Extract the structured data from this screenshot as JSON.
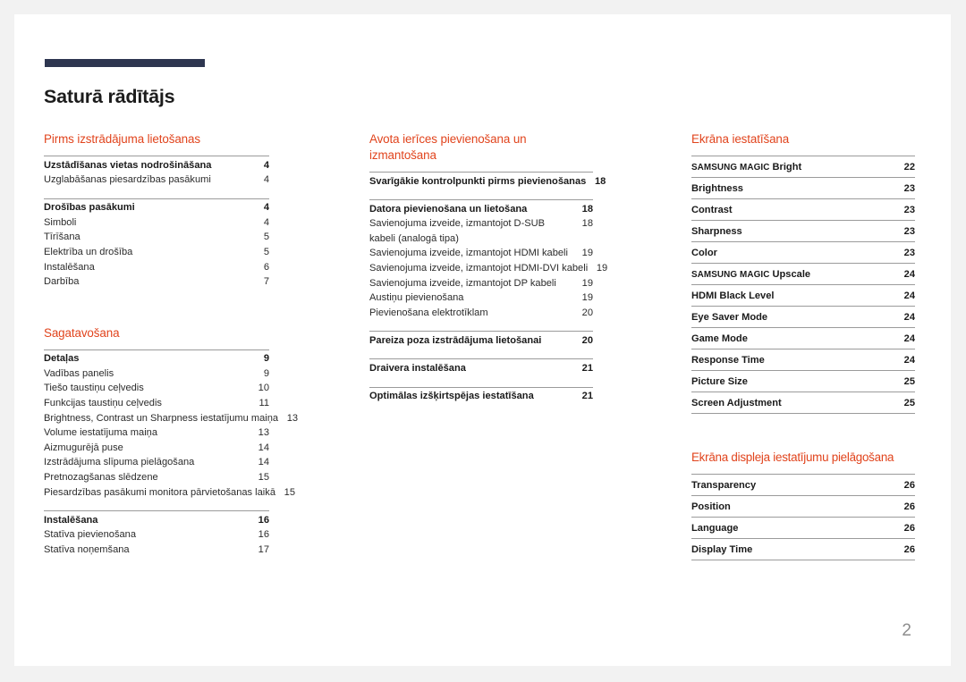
{
  "document": {
    "title": "Saturā rādītājs",
    "folio": "2",
    "accent_heading_color": "#e1441d",
    "rule_color": "#2e3650",
    "folio_color": "#8d8d8d"
  },
  "columns": [
    {
      "id": "column-1",
      "sections": [
        {
          "heading": "Pirms izstrādājuma lietošanas",
          "groups": [
            {
              "entries": [
                {
                  "label": "Uzstādīšanas vietas nodrošināšana",
                  "page": "4",
                  "level": "head"
                },
                {
                  "label": "Uzglabāšanas piesardzības pasākumi",
                  "page": "4",
                  "level": "sub"
                }
              ]
            },
            {
              "entries": [
                {
                  "label": "Drošības pasākumi",
                  "page": "4",
                  "level": "head"
                },
                {
                  "label": "Simboli",
                  "page": "4",
                  "level": "sub"
                },
                {
                  "label": "Tīrīšana",
                  "page": "5",
                  "level": "sub"
                },
                {
                  "label": "Elektrība un drošība",
                  "page": "5",
                  "level": "sub"
                },
                {
                  "label": "Instalēšana",
                  "page": "6",
                  "level": "sub"
                },
                {
                  "label": "Darbība",
                  "page": "7",
                  "level": "sub"
                }
              ]
            }
          ]
        },
        {
          "heading": "Sagatavošana",
          "groups": [
            {
              "entries": [
                {
                  "label": "Detaļas",
                  "page": "9",
                  "level": "head"
                },
                {
                  "label": "Vadības panelis",
                  "page": "9",
                  "level": "sub"
                },
                {
                  "label": "Tiešo taustiņu ceļvedis",
                  "page": "10",
                  "level": "sub"
                },
                {
                  "label": "Funkcijas taustiņu ceļvedis",
                  "page": "11",
                  "level": "sub"
                },
                {
                  "label": "Brightness, Contrast un Sharpness iestatījumu maiņa",
                  "page": "13",
                  "level": "sub"
                },
                {
                  "label": "Volume iestatījuma maiņa",
                  "page": "13",
                  "level": "sub"
                },
                {
                  "label": "Aizmugurējā puse",
                  "page": "14",
                  "level": "sub"
                },
                {
                  "label": "Izstrādājuma slīpuma pielāgošana",
                  "page": "14",
                  "level": "sub"
                },
                {
                  "label": "Pretnozagšanas slēdzene",
                  "page": "15",
                  "level": "sub"
                },
                {
                  "label": "Piesardzības pasākumi monitora pārvietošanas laikā",
                  "page": "15",
                  "level": "sub"
                }
              ]
            },
            {
              "entries": [
                {
                  "label": "Instalēšana",
                  "page": "16",
                  "level": "head"
                },
                {
                  "label": "Statīva pievienošana",
                  "page": "16",
                  "level": "sub"
                },
                {
                  "label": "Statīva noņemšana",
                  "page": "17",
                  "level": "sub"
                }
              ]
            }
          ]
        }
      ]
    },
    {
      "id": "column-2",
      "sections": [
        {
          "heading": "Avota ierīces pievienošana un izmantošana",
          "groups": [
            {
              "entries": [
                {
                  "label": "Svarīgākie kontrolpunkti pirms pievienošanas",
                  "page": "18",
                  "level": "head"
                }
              ]
            },
            {
              "entries": [
                {
                  "label": "Datora pievienošana un lietošana",
                  "page": "18",
                  "level": "head"
                },
                {
                  "label": "Savienojuma izveide, izmantojot D-SUB kabeli (analogā tipa)",
                  "page": "18",
                  "level": "sub-wrap"
                },
                {
                  "label": "Savienojuma izveide, izmantojot HDMI kabeli",
                  "page": "19",
                  "level": "sub"
                },
                {
                  "label": "Savienojuma izveide, izmantojot HDMI-DVI kabeli",
                  "page": "19",
                  "level": "sub"
                },
                {
                  "label": "Savienojuma izveide, izmantojot DP kabeli",
                  "page": "19",
                  "level": "sub"
                },
                {
                  "label": "Austiņu pievienošana",
                  "page": "19",
                  "level": "sub"
                },
                {
                  "label": "Pievienošana elektrotīklam",
                  "page": "20",
                  "level": "sub"
                }
              ]
            },
            {
              "entries": [
                {
                  "label": "Pareiza poza izstrādājuma lietošanai",
                  "page": "20",
                  "level": "head"
                }
              ]
            },
            {
              "entries": [
                {
                  "label": "Draivera instalēšana",
                  "page": "21",
                  "level": "head"
                }
              ]
            },
            {
              "entries": [
                {
                  "label": "Optimālas izšķirtspējas iestatīšana",
                  "page": "21",
                  "level": "head"
                }
              ]
            }
          ]
        }
      ]
    },
    {
      "id": "column-3",
      "sections": [
        {
          "heading": "Ekrāna iestatīšana",
          "ruled_entries": [
            {
              "label_small": "SAMSUNG MAGIC",
              "label": "Bright",
              "page": "22"
            },
            {
              "label": "Brightness",
              "page": "23"
            },
            {
              "label": "Contrast",
              "page": "23"
            },
            {
              "label": "Sharpness",
              "page": "23"
            },
            {
              "label": "Color",
              "page": "23"
            },
            {
              "label_small": "SAMSUNG MAGIC",
              "label": "Upscale",
              "page": "24"
            },
            {
              "label": "HDMI Black Level",
              "page": "24"
            },
            {
              "label": "Eye Saver Mode",
              "page": "24"
            },
            {
              "label": "Game Mode",
              "page": "24"
            },
            {
              "label": "Response Time",
              "page": "24"
            },
            {
              "label": "Picture Size",
              "page": "25"
            },
            {
              "label": "Screen Adjustment",
              "page": "25"
            }
          ]
        },
        {
          "heading": "Ekrāna displeja iestatījumu pielāgošana",
          "ruled_entries": [
            {
              "label": "Transparency",
              "page": "26"
            },
            {
              "label": "Position",
              "page": "26"
            },
            {
              "label": "Language",
              "page": "26"
            },
            {
              "label": "Display Time",
              "page": "26"
            }
          ]
        }
      ]
    }
  ]
}
